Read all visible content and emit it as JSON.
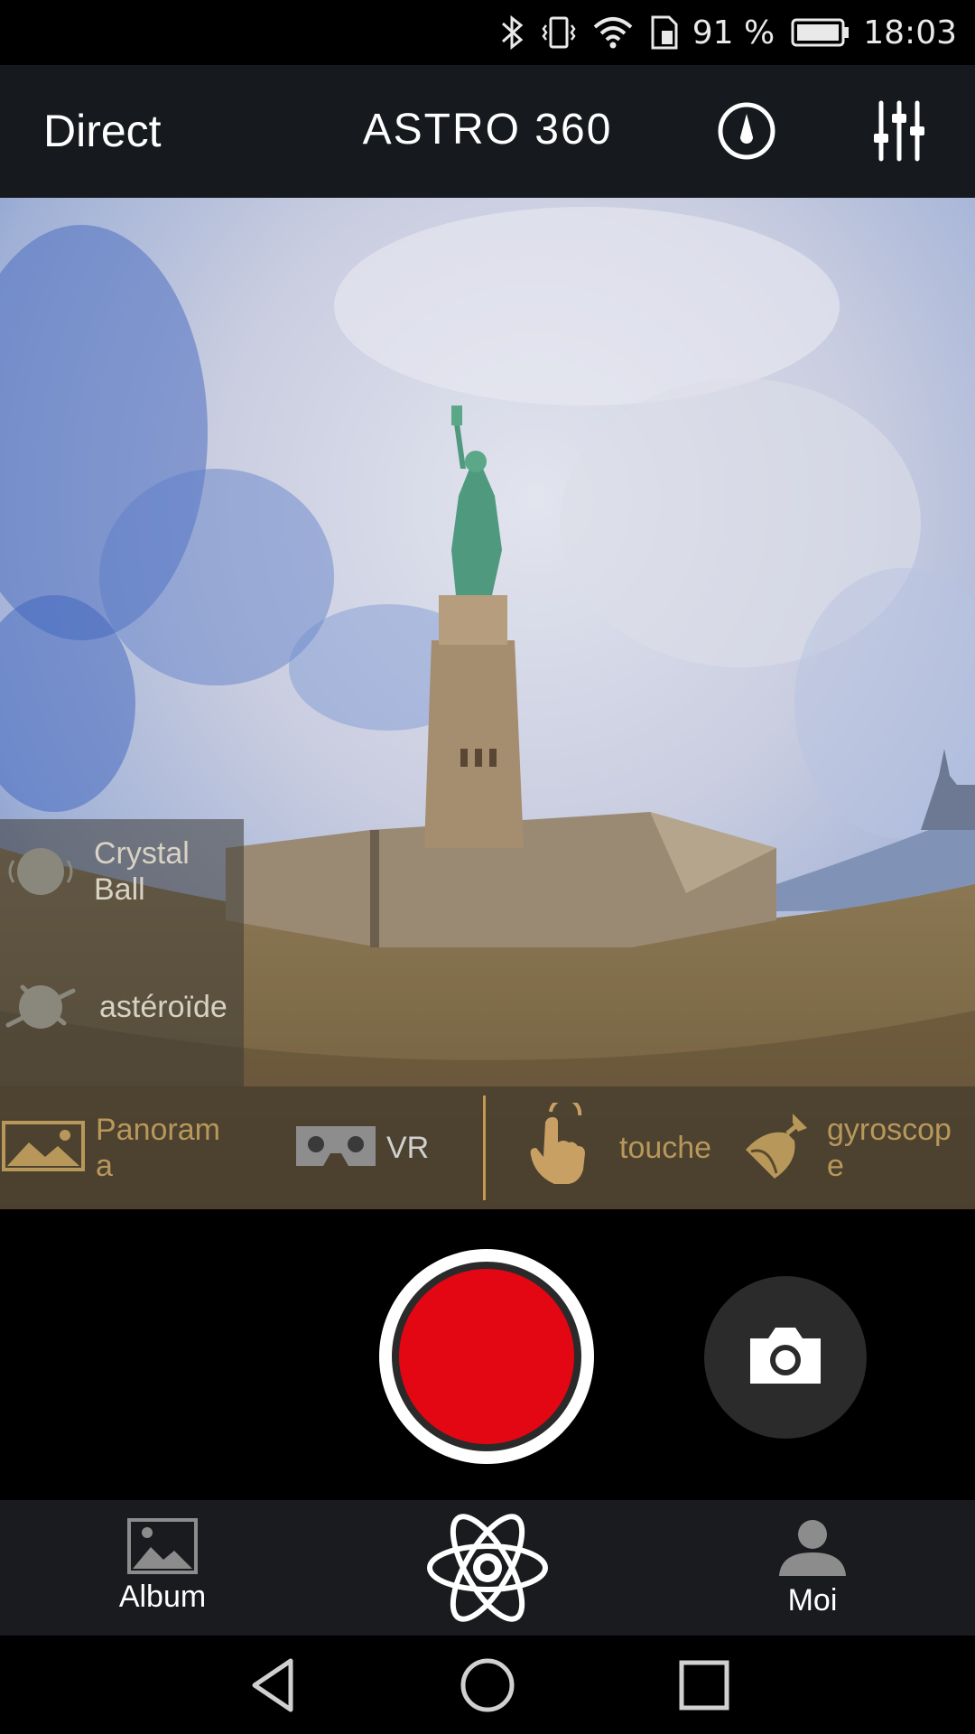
{
  "status_bar": {
    "battery_percent": "91 %",
    "time": "18:03",
    "icons": [
      "bluetooth-icon",
      "vibrate-icon",
      "wifi-icon",
      "sim-icon",
      "battery-icon"
    ]
  },
  "app_bar": {
    "left_title": "Direct",
    "center_title": "ASTRO 360",
    "icons": [
      "compass-icon",
      "tune-sliders-icon"
    ]
  },
  "viewer": {
    "modes": [
      {
        "label": "Crystal\nBall",
        "icon": "crystal-ball-icon"
      },
      {
        "label": "astéroïde",
        "icon": "asteroid-icon"
      }
    ],
    "controls": [
      {
        "label": "Panoram\na",
        "icon": "panorama-icon"
      },
      {
        "label": "VR",
        "icon": "vr-headset-icon"
      },
      {
        "label": "touche",
        "icon": "touch-hand-icon"
      },
      {
        "label": "gyroscop\ne",
        "icon": "gyroscope-icon"
      }
    ]
  },
  "capture": {
    "record_icon": "record-icon",
    "photo_icon": "camera-icon"
  },
  "bottom_nav": {
    "album_label": "Album",
    "me_label": "Moi",
    "icons": [
      "album-icon",
      "atom-eye-icon",
      "user-icon"
    ]
  },
  "system_nav": [
    "back-icon",
    "home-icon",
    "recents-icon"
  ],
  "colors": {
    "record_red": "#e30613",
    "accent_gold": "#c49a52",
    "app_bar_bg": "#16191d"
  }
}
